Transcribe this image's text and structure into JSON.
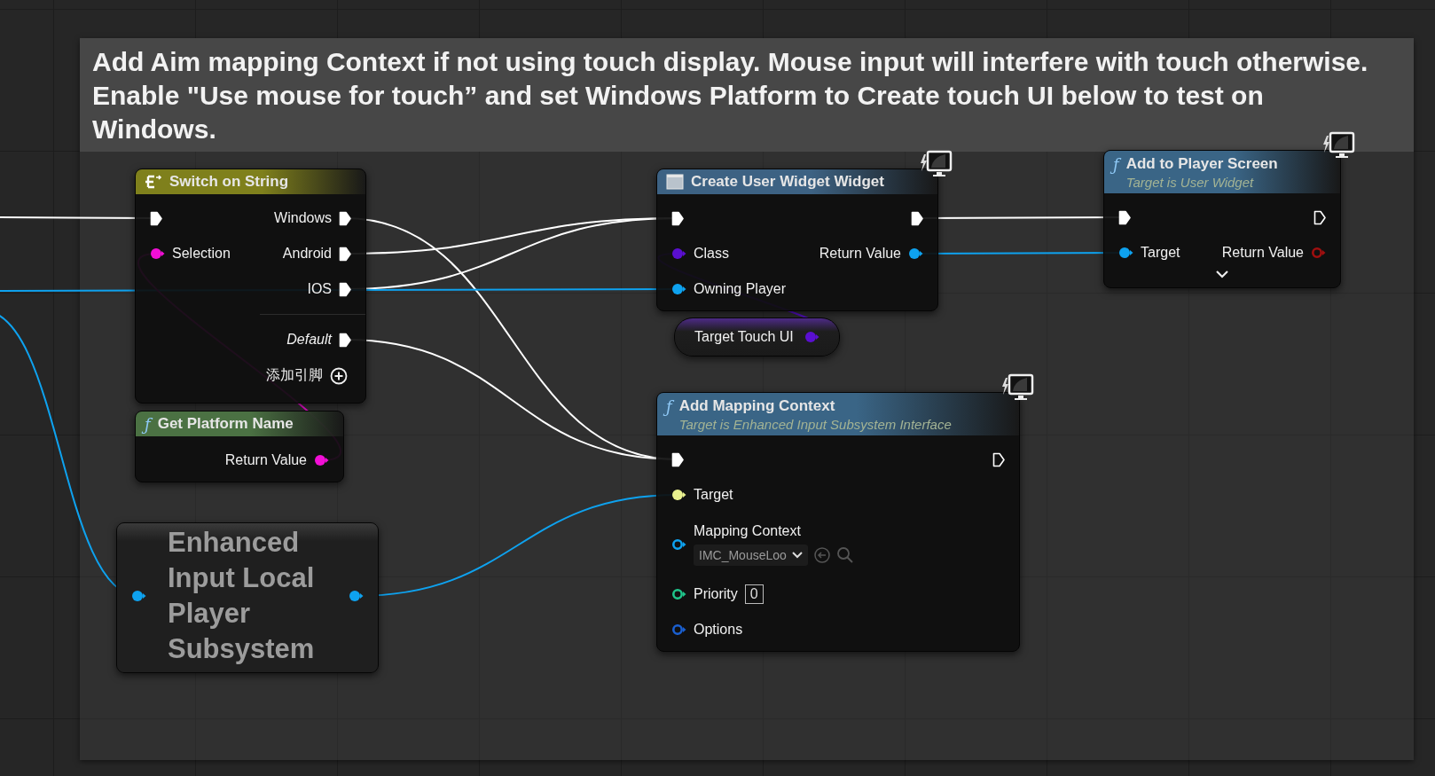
{
  "comment": {
    "text": "Add Aim mapping Context if not using touch display. Mouse input will interfere with touch otherwise. Enable \"Use mouse for touch” and set Windows Platform to Create touch UI below to test on Windows."
  },
  "nodes": [
    {
      "kind": "switch",
      "title": "Switch on String",
      "rows": [
        {
          "left": {
            "kind": "exec",
            "connected": true,
            "color": "#ffffff"
          },
          "right": {
            "kind": "exec",
            "label": "Windows",
            "connected": true,
            "color": "#ffffff"
          }
        },
        {
          "left": {
            "kind": "data",
            "label": "Selection",
            "connected": true,
            "color": "#f20fd6"
          },
          "right": {
            "kind": "exec",
            "label": "Android",
            "connected": true,
            "color": "#ffffff"
          }
        },
        {
          "right": {
            "kind": "exec",
            "label": "IOS",
            "connected": true,
            "color": "#ffffff"
          }
        },
        {
          "separator": true,
          "right": {
            "kind": "exec",
            "label": "Default",
            "italic": true,
            "connected": true,
            "color": "#ffffff"
          }
        }
      ],
      "add_pin": "添加引脚"
    },
    {
      "kind": "widget",
      "title": "Create User Widget Widget",
      "badge": true,
      "rows": [
        {
          "left": {
            "kind": "exec",
            "connected": true,
            "color": "#ffffff"
          },
          "right": {
            "kind": "exec",
            "connected": true,
            "color": "#ffffff"
          }
        },
        {
          "left": {
            "kind": "data",
            "label": "Class",
            "connected": true,
            "color": "#5a0fd0"
          },
          "right": {
            "kind": "data",
            "label": "Return Value",
            "connected": true,
            "color": "#0ea2ef"
          }
        },
        {
          "left": {
            "kind": "data",
            "label": "Owning Player",
            "connected": true,
            "color": "#0ea2ef"
          }
        }
      ]
    },
    {
      "kind": "function",
      "title": "Add to Player Screen",
      "glyph": "ƒ",
      "subtitle": "Target is User Widget",
      "badge": true,
      "expanded": false,
      "rows": [
        {
          "left": {
            "kind": "exec",
            "connected": true,
            "color": "#ffffff"
          },
          "right": {
            "kind": "exec",
            "connected": false,
            "color": "#ffffff"
          }
        },
        {
          "left": {
            "kind": "data",
            "label": "Target",
            "connected": true,
            "color": "#0ea2ef"
          },
          "right": {
            "kind": "data",
            "label": "Return Value",
            "connected": false,
            "color": "#a00f0f"
          }
        }
      ]
    },
    {
      "kind": "variable",
      "title": "Target Touch UI",
      "rows": [
        {
          "right": {
            "kind": "data",
            "connected": true,
            "color": "#5a0fd0"
          }
        }
      ]
    },
    {
      "kind": "function",
      "title": "Add Mapping Context",
      "glyph": "ƒ",
      "subtitle": "Target is Enhanced Input Subsystem Interface",
      "badge": true,
      "rows": [
        {
          "left": {
            "kind": "exec",
            "connected": true,
            "color": "#ffffff"
          },
          "right": {
            "kind": "exec",
            "connected": false,
            "color": "#ffffff"
          }
        },
        {
          "left": {
            "kind": "data",
            "label": "Target",
            "connected": true,
            "color": "#e8f08e"
          }
        },
        {
          "left": {
            "kind": "data",
            "label": "Mapping Context",
            "connected": false,
            "color": "#0ea2ef",
            "dropdown": "IMC_MouseLoo"
          }
        },
        {
          "left": {
            "kind": "data",
            "label": "Priority",
            "connected": false,
            "color": "#1fc48a",
            "value": "0"
          }
        },
        {
          "left": {
            "kind": "data",
            "label": "Options",
            "connected": false,
            "color": "#1a5fd0"
          }
        }
      ]
    },
    {
      "kind": "pure_function",
      "title": "Get Platform Name",
      "glyph": "ƒ",
      "rows": [
        {
          "right": {
            "kind": "data",
            "label": "Return Value",
            "connected": true,
            "color": "#f20fd6"
          }
        }
      ]
    },
    {
      "kind": "compact",
      "title": "Enhanced Input Local Player Subsystem",
      "rows": [
        {
          "left": {
            "kind": "data",
            "connected": true,
            "color": "#0ea2ef"
          },
          "right": {
            "kind": "data",
            "connected": true,
            "color": "#0ea2ef"
          }
        }
      ]
    }
  ]
}
